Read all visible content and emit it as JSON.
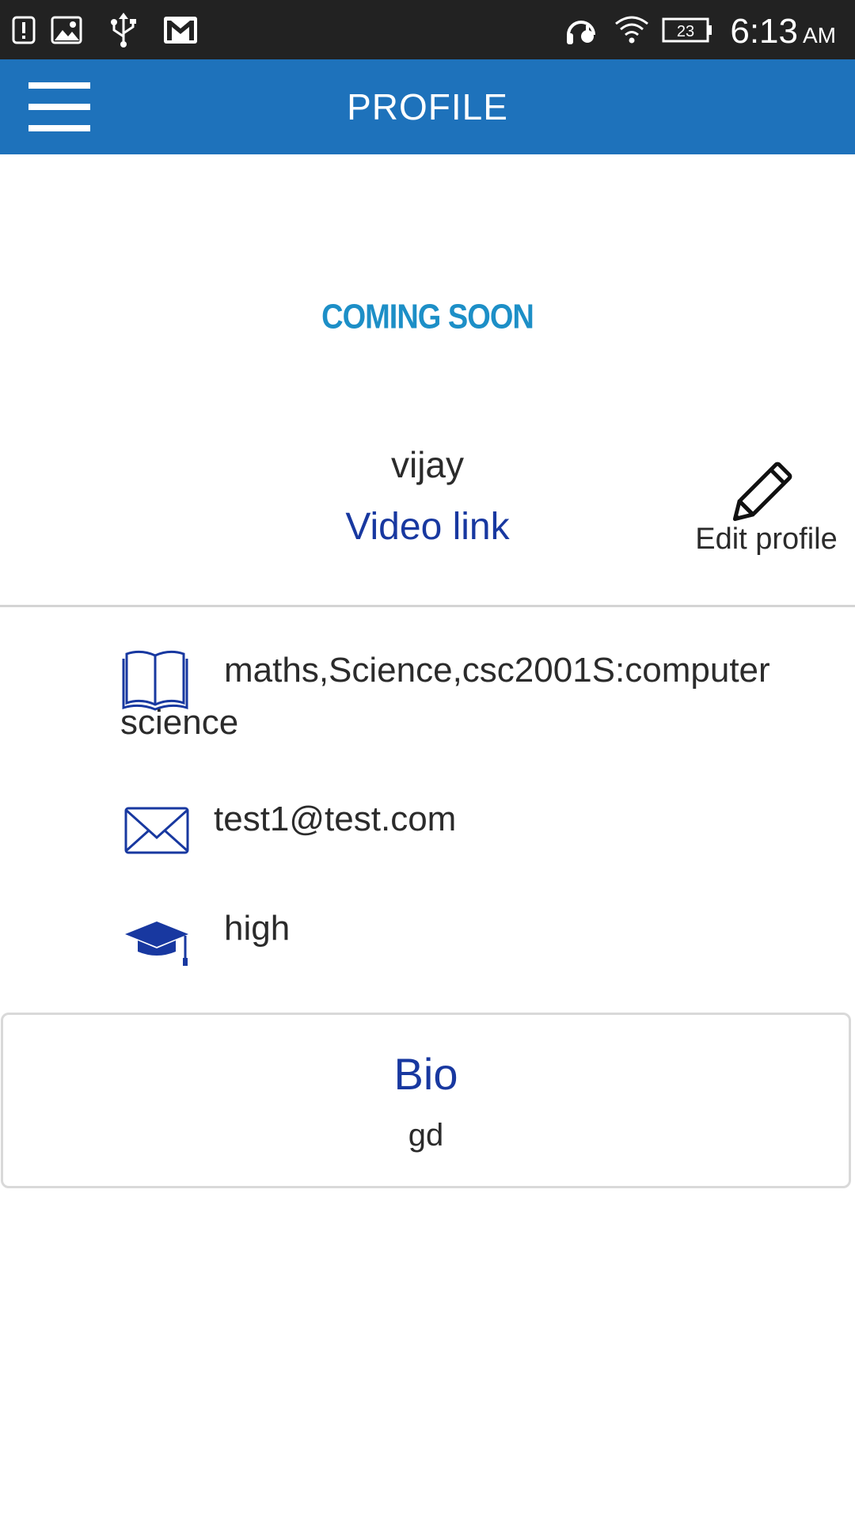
{
  "status_bar": {
    "time": "6:13",
    "ampm": "AM",
    "battery_level": "23",
    "icons": [
      "alert-icon",
      "image-icon",
      "usb-icon",
      "gmail-icon",
      "headset-icon",
      "wifi-icon",
      "battery-icon"
    ]
  },
  "app_bar": {
    "title": "PROFILE",
    "menu_icon": "hamburger-menu-icon"
  },
  "profile": {
    "banner": "COMING SOON",
    "name": "vijay",
    "video_link": "Video link",
    "edit_label": "Edit profile"
  },
  "info": {
    "subjects_line1": "maths,Science,csc2001S:computer",
    "subjects_line2": "science",
    "email": "test1@test.com",
    "level": "high"
  },
  "bio": {
    "title": "Bio",
    "text": "gd"
  },
  "colors": {
    "app_bar": "#1e72bb",
    "status_bar": "#222222",
    "link": "#1838a0",
    "banner": "#1d8fc7"
  }
}
